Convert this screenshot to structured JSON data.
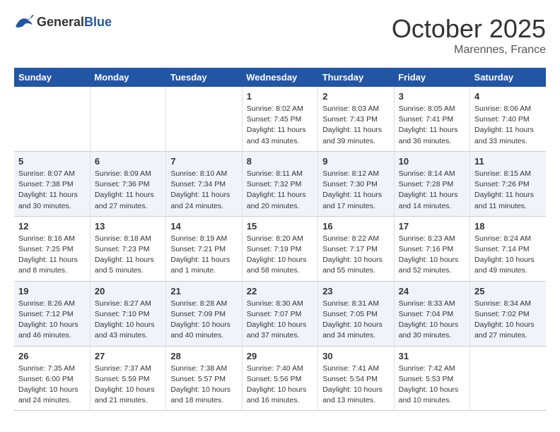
{
  "header": {
    "logo_general": "General",
    "logo_blue": "Blue",
    "month": "October 2025",
    "location": "Marennes, France"
  },
  "days_of_week": [
    "Sunday",
    "Monday",
    "Tuesday",
    "Wednesday",
    "Thursday",
    "Friday",
    "Saturday"
  ],
  "weeks": [
    [
      {
        "day": "",
        "text": ""
      },
      {
        "day": "",
        "text": ""
      },
      {
        "day": "",
        "text": ""
      },
      {
        "day": "1",
        "text": "Sunrise: 8:02 AM\nSunset: 7:45 PM\nDaylight: 11 hours\nand 43 minutes."
      },
      {
        "day": "2",
        "text": "Sunrise: 8:03 AM\nSunset: 7:43 PM\nDaylight: 11 hours\nand 39 minutes."
      },
      {
        "day": "3",
        "text": "Sunrise: 8:05 AM\nSunset: 7:41 PM\nDaylight: 11 hours\nand 36 minutes."
      },
      {
        "day": "4",
        "text": "Sunrise: 8:06 AM\nSunset: 7:40 PM\nDaylight: 11 hours\nand 33 minutes."
      }
    ],
    [
      {
        "day": "5",
        "text": "Sunrise: 8:07 AM\nSunset: 7:38 PM\nDaylight: 11 hours\nand 30 minutes."
      },
      {
        "day": "6",
        "text": "Sunrise: 8:09 AM\nSunset: 7:36 PM\nDaylight: 11 hours\nand 27 minutes."
      },
      {
        "day": "7",
        "text": "Sunrise: 8:10 AM\nSunset: 7:34 PM\nDaylight: 11 hours\nand 24 minutes."
      },
      {
        "day": "8",
        "text": "Sunrise: 8:11 AM\nSunset: 7:32 PM\nDaylight: 11 hours\nand 20 minutes."
      },
      {
        "day": "9",
        "text": "Sunrise: 8:12 AM\nSunset: 7:30 PM\nDaylight: 11 hours\nand 17 minutes."
      },
      {
        "day": "10",
        "text": "Sunrise: 8:14 AM\nSunset: 7:28 PM\nDaylight: 11 hours\nand 14 minutes."
      },
      {
        "day": "11",
        "text": "Sunrise: 8:15 AM\nSunset: 7:26 PM\nDaylight: 11 hours\nand 11 minutes."
      }
    ],
    [
      {
        "day": "12",
        "text": "Sunrise: 8:16 AM\nSunset: 7:25 PM\nDaylight: 11 hours\nand 8 minutes."
      },
      {
        "day": "13",
        "text": "Sunrise: 8:18 AM\nSunset: 7:23 PM\nDaylight: 11 hours\nand 5 minutes."
      },
      {
        "day": "14",
        "text": "Sunrise: 8:19 AM\nSunset: 7:21 PM\nDaylight: 11 hours\nand 1 minute."
      },
      {
        "day": "15",
        "text": "Sunrise: 8:20 AM\nSunset: 7:19 PM\nDaylight: 10 hours\nand 58 minutes."
      },
      {
        "day": "16",
        "text": "Sunrise: 8:22 AM\nSunset: 7:17 PM\nDaylight: 10 hours\nand 55 minutes."
      },
      {
        "day": "17",
        "text": "Sunrise: 8:23 AM\nSunset: 7:16 PM\nDaylight: 10 hours\nand 52 minutes."
      },
      {
        "day": "18",
        "text": "Sunrise: 8:24 AM\nSunset: 7:14 PM\nDaylight: 10 hours\nand 49 minutes."
      }
    ],
    [
      {
        "day": "19",
        "text": "Sunrise: 8:26 AM\nSunset: 7:12 PM\nDaylight: 10 hours\nand 46 minutes."
      },
      {
        "day": "20",
        "text": "Sunrise: 8:27 AM\nSunset: 7:10 PM\nDaylight: 10 hours\nand 43 minutes."
      },
      {
        "day": "21",
        "text": "Sunrise: 8:28 AM\nSunset: 7:09 PM\nDaylight: 10 hours\nand 40 minutes."
      },
      {
        "day": "22",
        "text": "Sunrise: 8:30 AM\nSunset: 7:07 PM\nDaylight: 10 hours\nand 37 minutes."
      },
      {
        "day": "23",
        "text": "Sunrise: 8:31 AM\nSunset: 7:05 PM\nDaylight: 10 hours\nand 34 minutes."
      },
      {
        "day": "24",
        "text": "Sunrise: 8:33 AM\nSunset: 7:04 PM\nDaylight: 10 hours\nand 30 minutes."
      },
      {
        "day": "25",
        "text": "Sunrise: 8:34 AM\nSunset: 7:02 PM\nDaylight: 10 hours\nand 27 minutes."
      }
    ],
    [
      {
        "day": "26",
        "text": "Sunrise: 7:35 AM\nSunset: 6:00 PM\nDaylight: 10 hours\nand 24 minutes."
      },
      {
        "day": "27",
        "text": "Sunrise: 7:37 AM\nSunset: 5:59 PM\nDaylight: 10 hours\nand 21 minutes."
      },
      {
        "day": "28",
        "text": "Sunrise: 7:38 AM\nSunset: 5:57 PM\nDaylight: 10 hours\nand 18 minutes."
      },
      {
        "day": "29",
        "text": "Sunrise: 7:40 AM\nSunset: 5:56 PM\nDaylight: 10 hours\nand 16 minutes."
      },
      {
        "day": "30",
        "text": "Sunrise: 7:41 AM\nSunset: 5:54 PM\nDaylight: 10 hours\nand 13 minutes."
      },
      {
        "day": "31",
        "text": "Sunrise: 7:42 AM\nSunset: 5:53 PM\nDaylight: 10 hours\nand 10 minutes."
      },
      {
        "day": "",
        "text": ""
      }
    ]
  ]
}
